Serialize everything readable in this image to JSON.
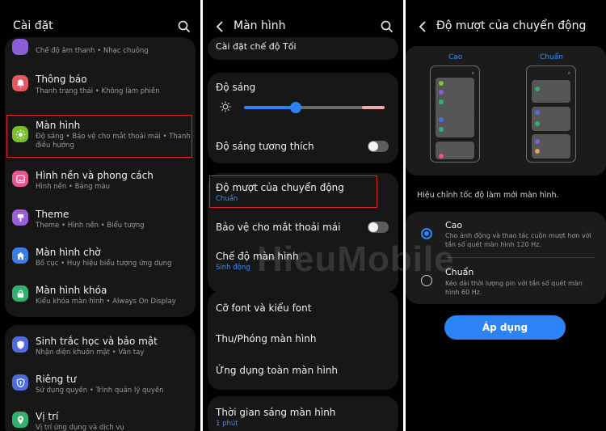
{
  "screen1": {
    "title": "Cài đặt",
    "items": [
      {
        "sub": "Chế độ âm thanh • Nhạc chuông"
      },
      {
        "label": "Thông báo",
        "sub": "Thanh trạng thái • Không làm phiền",
        "icon": "bell-icon",
        "color": "#e05a5f"
      },
      {
        "label": "Màn hình",
        "sub": "Độ sáng • Bảo vệ cho mắt thoải mái • Thanh",
        "sub2": "điều hướng",
        "icon": "sun-icon",
        "color": "#7cbf2d"
      },
      {
        "label": "Hình nền và phong cách",
        "sub": "Hình nền • Bảng màu",
        "icon": "image-icon",
        "color": "#e9558f"
      },
      {
        "label": "Theme",
        "sub": "Theme • Hình nền • Biểu tượng",
        "icon": "palette-icon",
        "color": "#9b5fd6"
      },
      {
        "label": "Màn hình chờ",
        "sub": "Bố cục • Huy hiệu biểu tượng ứng dụng",
        "icon": "home-icon",
        "color": "#3b7de8"
      },
      {
        "label": "Màn hình khóa",
        "sub": "Kiểu khóa màn hình • Always On Display",
        "icon": "lock-icon",
        "color": "#33b06e"
      },
      {
        "label": "Sinh trắc học và bảo mật",
        "sub": "Nhận diện khuôn mặt • Vân tay",
        "icon": "shield-icon",
        "color": "#4f6bde"
      },
      {
        "label": "Riêng tư",
        "sub": "Sử dụng quyền • Trình quản lý quyền",
        "icon": "privacy-icon",
        "color": "#4f6bde"
      },
      {
        "label": "Vị trí",
        "sub": "Vị trí ứng dụng và dịch vụ",
        "icon": "location-icon",
        "color": "#33b06e"
      }
    ]
  },
  "screen2": {
    "title": "Màn hình",
    "dark_mode_settings": "Cài đặt chế độ Tối",
    "brightness": {
      "label": "Độ sáng",
      "value": 0.37
    },
    "adaptive_brightness": "Độ sáng tương thích",
    "motion_smoothness": {
      "label": "Độ mượt của chuyển động",
      "value": "Chuẩn"
    },
    "eye_comfort": "Bảo vệ cho mắt thoải mái",
    "screen_mode": {
      "label": "Chế độ màn hình",
      "value": "Sinh động"
    },
    "font": "Cỡ font và kiểu font",
    "zoom": "Thu/Phóng màn hình",
    "full_screen_apps": "Ứng dụng toàn màn hình",
    "screen_timeout": {
      "label": "Thời gian sáng màn hình",
      "value": "1 phút"
    }
  },
  "screen3": {
    "title": "Độ mượt của chuyển động",
    "preview_high": "Cao",
    "preview_std": "Chuẩn",
    "description": "Hiệu chỉnh tốc độ làm mới màn hình.",
    "options": [
      {
        "label": "Cao",
        "desc1": "Cho ảnh động và thao tác cuộn mượt hơn với",
        "desc2": "tần số quét màn hình 120 Hz.",
        "selected": true
      },
      {
        "label": "Chuẩn",
        "desc1": "Kéo dài thời lượng pin với tần số quét màn",
        "desc2": "hình 60 Hz.",
        "selected": false
      }
    ],
    "apply": "Áp dụng"
  },
  "watermark": "HieuMobile",
  "colors": {
    "accent": "#2b83f6",
    "highlight": "#e2262b",
    "slider_end": "#f1a9a9",
    "card": "#171717"
  }
}
